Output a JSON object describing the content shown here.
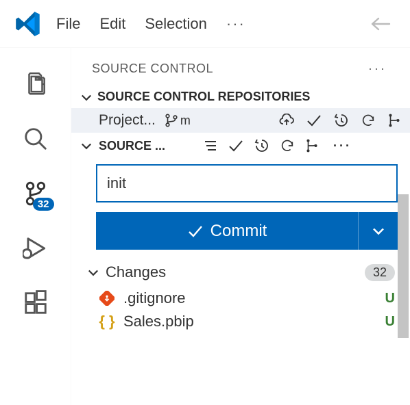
{
  "menubar": {
    "items": [
      "File",
      "Edit",
      "Selection"
    ]
  },
  "activitybar": {
    "badge": "32"
  },
  "panel": {
    "title": "SOURCE CONTROL",
    "repos": {
      "label": "SOURCE CONTROL REPOSITORIES",
      "item": {
        "name": "Project...",
        "branch_abbrev": "m"
      }
    },
    "providers": {
      "label": "SOURCE ..."
    },
    "commit": {
      "message": "init",
      "button_label": "Commit"
    },
    "changes": {
      "label": "Changes",
      "count": "32",
      "files": [
        {
          "name": ".gitignore",
          "status": "U",
          "icon_color": "#e64a19",
          "icon": "git"
        },
        {
          "name": "Sales.pbip",
          "status": "U",
          "icon_color": "#d4a017",
          "icon": "braces"
        }
      ]
    }
  }
}
